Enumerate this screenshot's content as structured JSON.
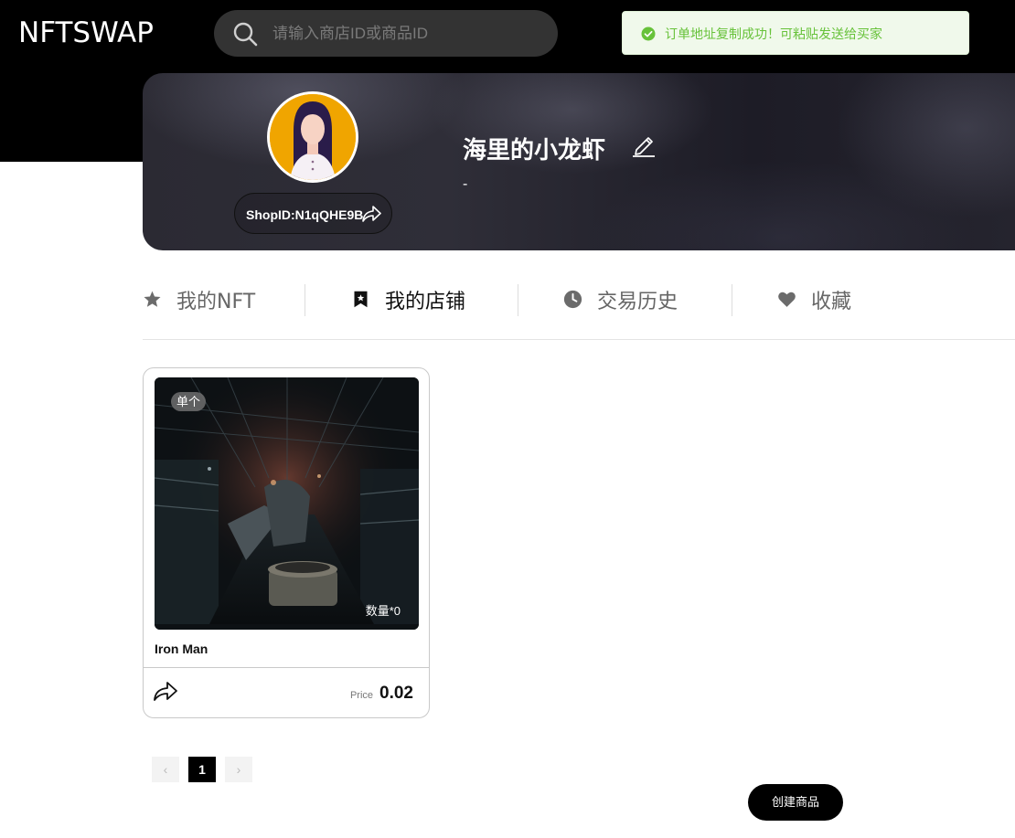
{
  "header": {
    "logo": "NFTSWAP",
    "search_placeholder": "请输入商店ID或商品ID"
  },
  "toast": {
    "message": "订单地址复制成功！可粘贴发送给买家",
    "color": "#67c23a"
  },
  "profile": {
    "shop_name": "海里的小龙虾",
    "description": "-",
    "shop_id": "ShopID:N1qQHE9B"
  },
  "tabs": [
    {
      "label": "我的NFT",
      "icon": "star-icon",
      "active": false
    },
    {
      "label": "我的店铺",
      "icon": "bookmark-icon",
      "active": true
    },
    {
      "label": "交易历史",
      "icon": "clock-icon",
      "active": false
    },
    {
      "label": "收藏",
      "icon": "heart-icon",
      "active": false
    }
  ],
  "products": [
    {
      "badge": "单个",
      "quantity": "数量*0",
      "title": "Iron Man",
      "price_label": "Price",
      "price": "0.02"
    }
  ],
  "pagination": {
    "prev": "‹",
    "current": "1",
    "next": "›"
  },
  "actions": {
    "create_product": "创建商品"
  }
}
